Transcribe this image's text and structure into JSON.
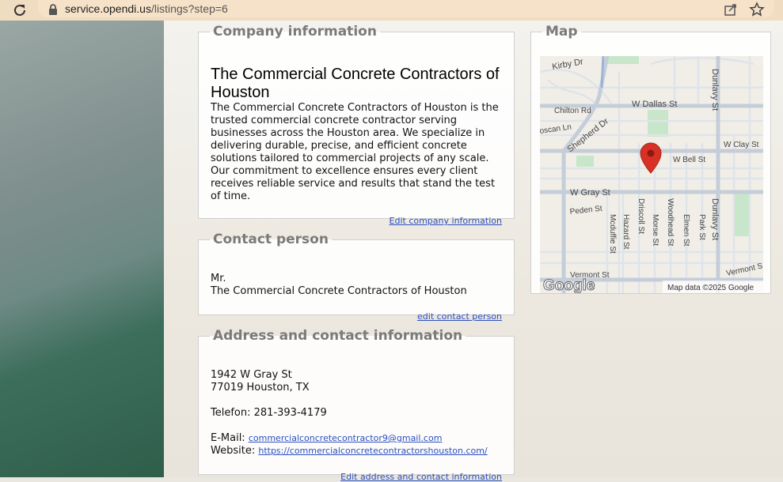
{
  "browser": {
    "url_host": "service.opendi.us",
    "url_path": "/listings?step=6"
  },
  "company": {
    "legend": "Company information",
    "title": "The Commercial Concrete Contractors of Houston",
    "description": "The Commercial Concrete Contractors of Houston is the trusted commercial concrete contractor serving businesses across the Houston area. We specialize in delivering durable, precise, and efficient concrete solutions tailored to commercial projects of any scale. Our commitment to excellence ensures every client receives reliable service and results that stand the test of time.",
    "edit_link": "Edit company information"
  },
  "contact": {
    "legend": "Contact person",
    "salutation": "Mr.",
    "name": "The Commercial Concrete Contractors of Houston",
    "edit_link": "edit contact person"
  },
  "address": {
    "legend": "Address and contact information",
    "street": "1942 W Gray St",
    "city": "77019 Houston, TX",
    "phone_label": "Telefon:",
    "phone": "281-393-4179",
    "email_label": "E-Mail:",
    "email": "commercialconcretecontractor9@gmail.com",
    "website_label": "Website:",
    "website": "https://commercialconcretecontractorshouston.com/",
    "edit_link": "Edit address and contact information"
  },
  "map": {
    "legend": "Map",
    "attribution": "Map data ©2025 Google",
    "logo": "Google",
    "streets": {
      "kirby": "Kirby Dr",
      "dallas": "W Dallas St",
      "chilton": "Chilton Rd",
      "dunlavy_top": "Dunlavy St",
      "toscan": "oscan Ln",
      "shepherd": "Shepherd Dr",
      "clay": "W Clay St",
      "bell": "W Bell St",
      "gray": "W Gray St",
      "peden": "Peden St",
      "mcduffie": "Mcduffie St",
      "hazard": "Hazard St",
      "driscoll": "Driscoll St",
      "morse": "Morse St",
      "woodhead": "Woodhead St",
      "elmen": "Elmen St",
      "park": "Park St",
      "dunlavy_bottom": "Dunlavy St",
      "vermont_left": "Vermont St",
      "vermont_right": "Vermont S"
    },
    "marker_color": "#d93025"
  }
}
